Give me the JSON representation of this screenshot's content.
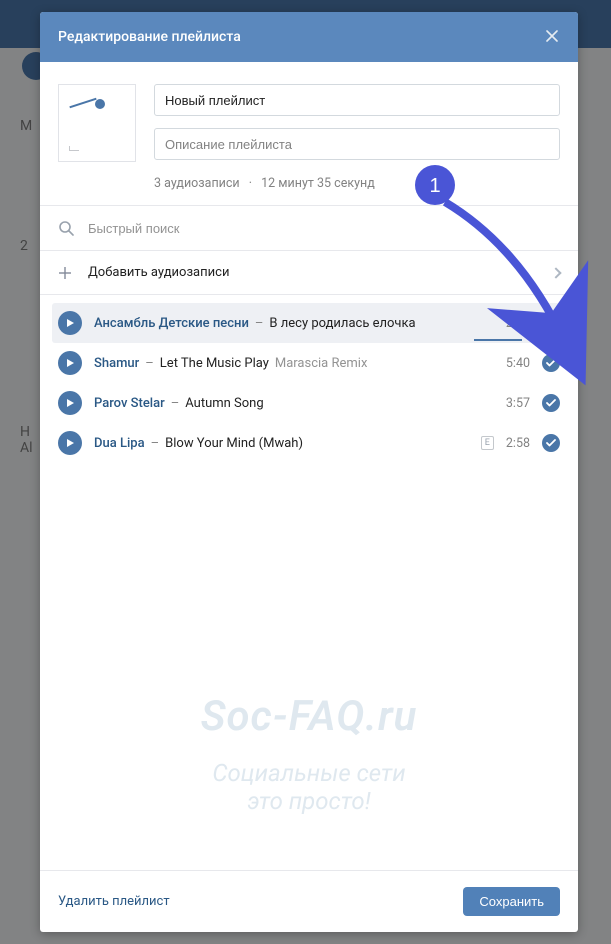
{
  "dialog": {
    "title": "Редактирование плейлиста",
    "playlist_name": "Новый плейлист",
    "description_placeholder": "Описание плейлиста",
    "counts_tracks": "3 аудиозаписи",
    "counts_duration": "12 минут 35 секунд",
    "search_placeholder": "Быстрый поиск",
    "add_label": "Добавить аудиозаписи",
    "delete_label": "Удалить плейлист",
    "save_label": "Сохранить"
  },
  "tracks": [
    {
      "artist": "Ансамбль Детские песни",
      "title": "В лесу родилась елочка",
      "remix": "",
      "duration": "2:09",
      "selected": false,
      "explicit": false,
      "highlight": true
    },
    {
      "artist": "Shamur",
      "title": "Let The Music Play",
      "remix": "Marascia Remix",
      "duration": "5:40",
      "selected": true,
      "explicit": false,
      "highlight": false
    },
    {
      "artist": "Parov Stelar",
      "title": "Autumn Song",
      "remix": "",
      "duration": "3:57",
      "selected": true,
      "explicit": false,
      "highlight": false
    },
    {
      "artist": "Dua Lipa",
      "title": "Blow Your Mind (Mwah)",
      "remix": "",
      "duration": "2:58",
      "selected": true,
      "explicit": true,
      "highlight": false
    }
  ],
  "annotation": {
    "badge": "1"
  },
  "watermark": {
    "line1": "Soc-FAQ.ru",
    "line2": "Социальные сети",
    "line3": "это просто!"
  },
  "background": {
    "left1": "М",
    "left2": "2",
    "left3": "Н",
    "left4": "Al"
  }
}
